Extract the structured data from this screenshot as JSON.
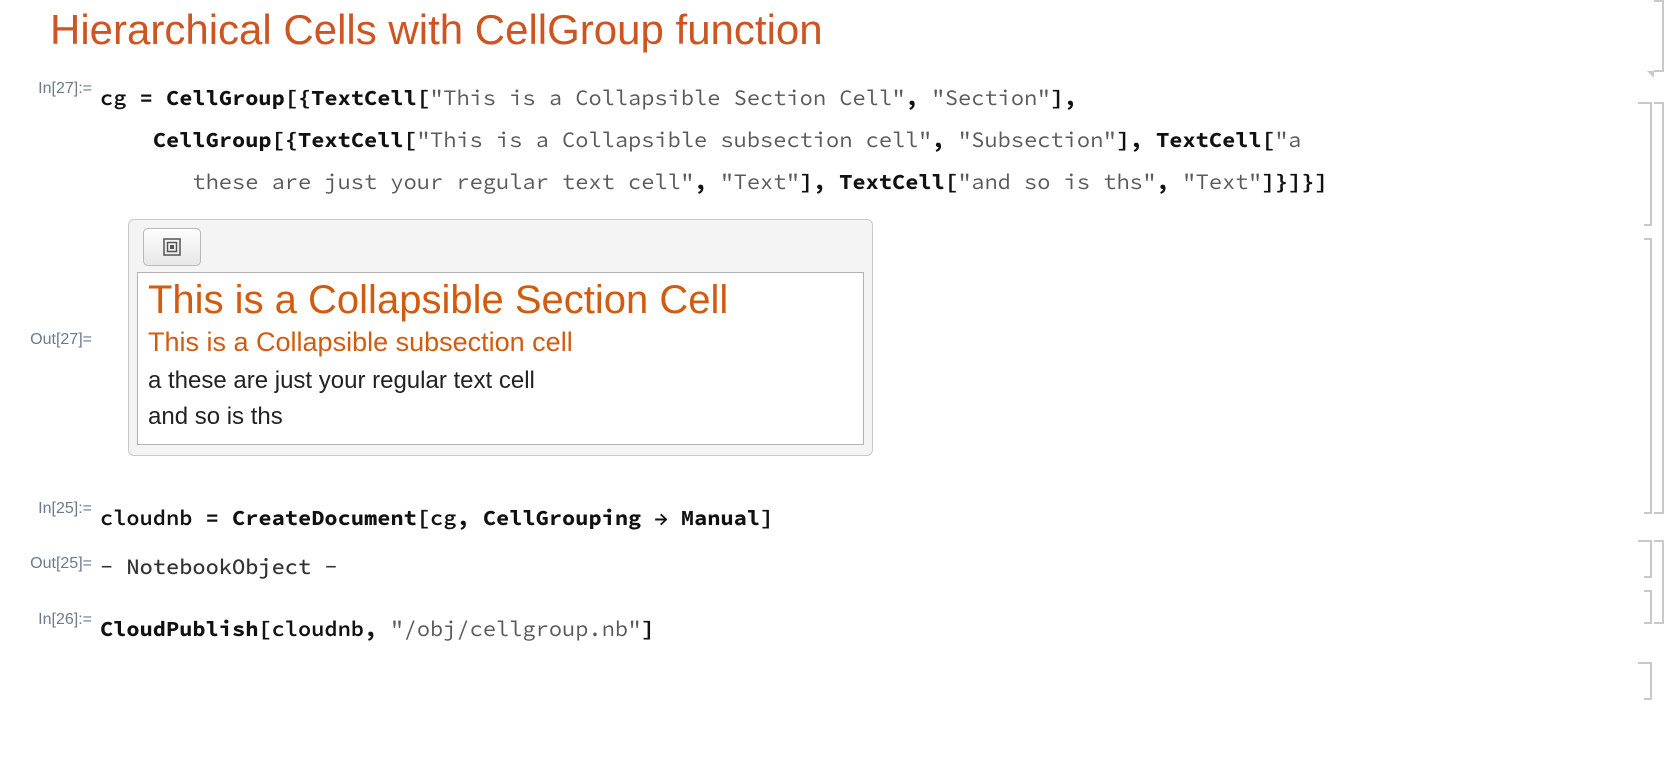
{
  "heading": "Hierarchical Cells with CellGroup function",
  "labels": {
    "in27": "In[27]:=",
    "out27": "Out[27]=",
    "in25": "In[25]:=",
    "out25": "Out[25]=",
    "in26": "In[26]:="
  },
  "code27": {
    "p1a": "cg",
    "p1b": " = ",
    "p1c": "CellGroup",
    "p1d": "[",
    "p1e": "{",
    "p1f": "TextCell",
    "p1g": "[",
    "p1h": "\"This is a Collapsible Section Cell\"",
    "p1i": ", ",
    "p1j": "\"Section\"",
    "p1k": "]",
    "p1l": ",",
    "p2a": "    ",
    "p2b": "CellGroup",
    "p2c": "[",
    "p2d": "{",
    "p2e": "TextCell",
    "p2f": "[",
    "p2g": "\"This is a Collapsible subsection cell\"",
    "p2h": ", ",
    "p2i": "\"Subsection\"",
    "p2j": "]",
    "p2k": ", ",
    "p2l": "TextCell",
    "p2m": "[",
    "p2n": "\"a",
    "p3a": "       these are just your regular text cell\"",
    "p3b": ", ",
    "p3c": "\"Text\"",
    "p3d": "]",
    "p3e": ", ",
    "p3f": "TextCell",
    "p3g": "[",
    "p3h": "\"and so is ths\"",
    "p3i": ", ",
    "p3j": "\"Text\"",
    "p3k": "]",
    "p3l": "}",
    "p3m": "]",
    "p3n": "}",
    "p3o": "]"
  },
  "out27_panel": {
    "section": "This is a Collapsible Section Cell",
    "subsection": "This is a Collapsible subsection cell",
    "text1": "a these are just your regular text cell",
    "text2": "and so is ths"
  },
  "code25": {
    "a": "cloudnb",
    "b": " = ",
    "c": "CreateDocument",
    "d": "[",
    "e": "cg",
    "f": ", ",
    "g": "CellGrouping",
    "h": " → ",
    "i": "Manual",
    "j": "]"
  },
  "out25_text": "- NotebookObject -",
  "code26": {
    "a": "CloudPublish",
    "b": "[",
    "c": "cloudnb",
    "d": ", ",
    "e": "\"/obj/cellgroup.nb\"",
    "f": "]"
  },
  "icon_names": {
    "expand": "expand-cells-icon"
  }
}
